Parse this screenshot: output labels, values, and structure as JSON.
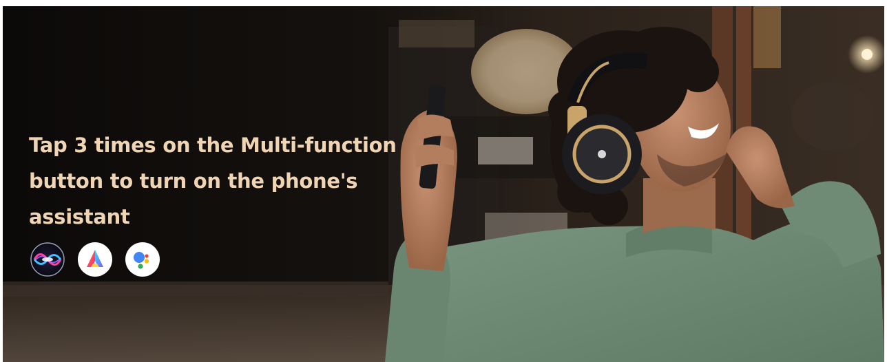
{
  "banner": {
    "headline_line1": "Tap 3 times on the Multi-function",
    "headline_line2": "button to turn on the phone's",
    "headline_line3": "assistant",
    "text_color": "#f0d5b4",
    "accent_gold": "#c9a46a",
    "shirt_color": "#6e8a74"
  },
  "assistants": [
    {
      "name": "siri",
      "icon": "siri-icon"
    },
    {
      "name": "huawei-celia",
      "icon": "celia-icon"
    },
    {
      "name": "google-assistant",
      "icon": "google-assistant-icon"
    }
  ]
}
